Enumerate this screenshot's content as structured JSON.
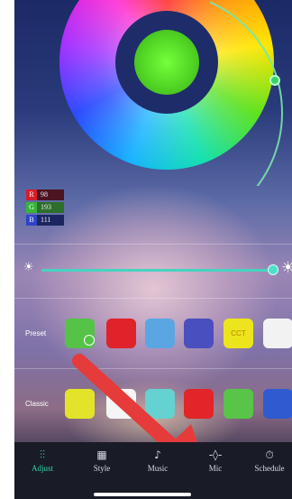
{
  "rgb_readout": {
    "r": {
      "label": "R",
      "value": "98"
    },
    "g": {
      "label": "G",
      "value": "193"
    },
    "b": {
      "label": "B",
      "value": "111"
    }
  },
  "color_wheel": {
    "center_color": "#4fd123",
    "handle_color": "#39d26a"
  },
  "brightness": {
    "level_fraction": 0.95,
    "accent_color": "#46d3c0",
    "min_icon": "sun-dim-icon",
    "max_icon": "sun-bright-icon"
  },
  "preset": {
    "label": "Preset",
    "swatches": [
      {
        "color": "#55c348",
        "text": "",
        "selected": true
      },
      {
        "color": "#e0232a",
        "text": ""
      },
      {
        "color": "#5aa6e2",
        "text": ""
      },
      {
        "color": "#4a4fc0",
        "text": ""
      },
      {
        "color": "#ece51d",
        "text": "CCT"
      },
      {
        "color": "#f2f2f2",
        "text": ""
      }
    ]
  },
  "classic": {
    "label": "Classic",
    "swatches": [
      {
        "color": "#e3e42a"
      },
      {
        "color": "#f5f5f5"
      },
      {
        "color": "#63d2d0"
      },
      {
        "color": "#e12528"
      },
      {
        "color": "#58c448"
      },
      {
        "color": "#2f5bd0"
      }
    ]
  },
  "tabs": [
    {
      "label": "Adjust",
      "icon": "sliders-icon",
      "glyph": "⫶⫶",
      "active": true
    },
    {
      "label": "Style",
      "icon": "grid-icon",
      "glyph": "▦"
    },
    {
      "label": "Music",
      "icon": "music-note-icon",
      "glyph": "♪"
    },
    {
      "label": "Mic",
      "icon": "microphone-icon",
      "glyph": "-◊-"
    },
    {
      "label": "Schedule",
      "icon": "timer-icon",
      "glyph": "⏱"
    }
  ],
  "accent_color": "#2fd5a9",
  "annotation_arrow_color": "#e53b3b"
}
